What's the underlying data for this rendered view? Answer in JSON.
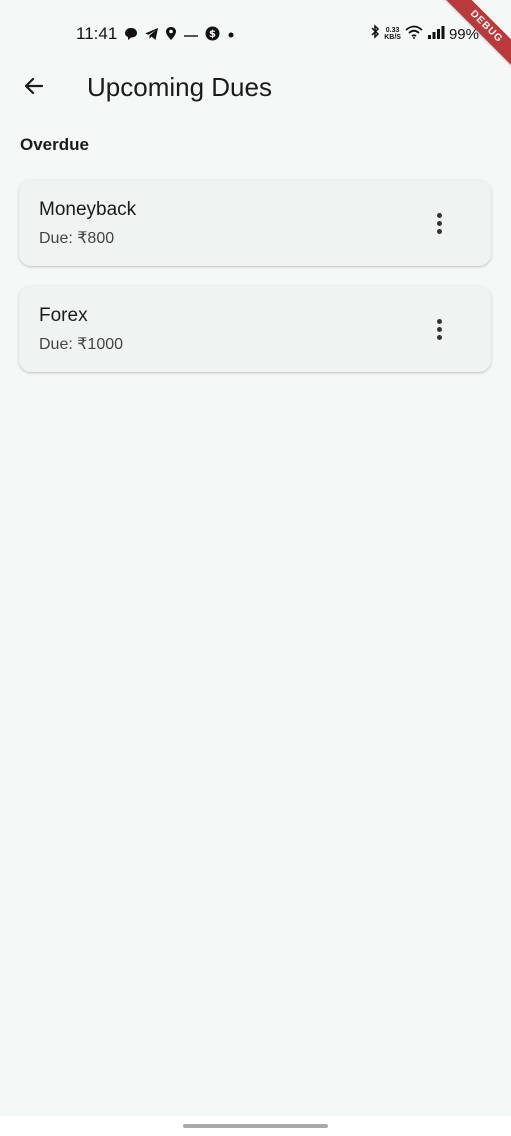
{
  "status_bar": {
    "time": "11:41",
    "network_speed_value": "0.33",
    "network_speed_unit": "KB/S",
    "battery": "99%",
    "icons": [
      "message-icon",
      "telegram-icon",
      "location-icon",
      "small-text-icon",
      "dollar-icon",
      "dot-icon",
      "bluetooth-icon",
      "wifi-icon",
      "signal-icon"
    ]
  },
  "debug_banner": "DEBUG",
  "app_bar": {
    "title": "Upcoming Dues"
  },
  "section": {
    "heading": "Overdue"
  },
  "dues": [
    {
      "name": "Moneyback",
      "due": "Due: ₹800"
    },
    {
      "name": "Forex",
      "due": "Due: ₹1000"
    }
  ],
  "colors": {
    "background": "#f4f8f6",
    "card": "#eff3f1",
    "debug_banner": "#b93a3a"
  }
}
